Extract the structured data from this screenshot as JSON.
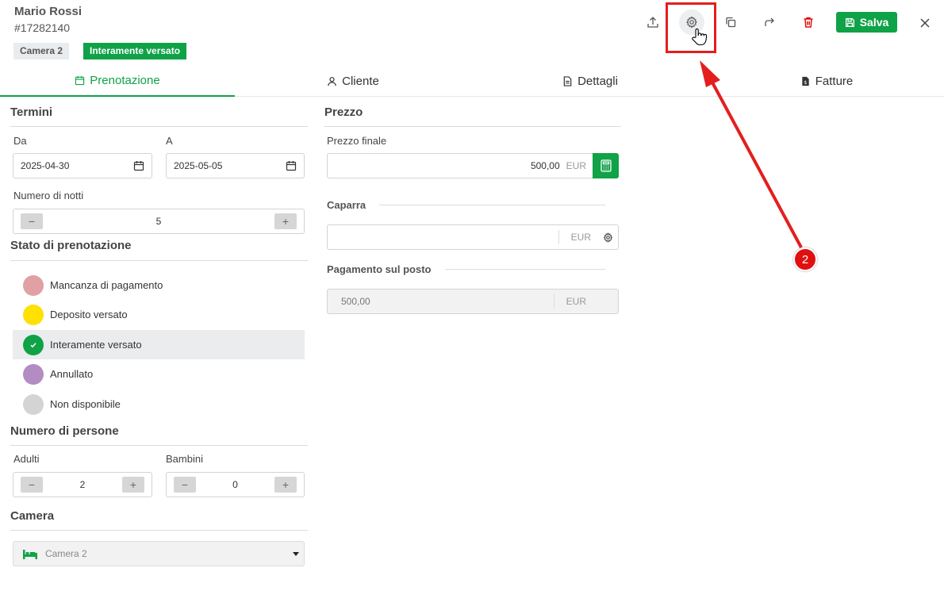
{
  "header": {
    "guest_name": "Mario Rossi",
    "booking_id": "#17282140",
    "room_tag": "Camera 2",
    "status_tag": "Interamente versato",
    "save_label": "Salva",
    "icons": [
      "upload-icon",
      "gear-icon",
      "copy-icon",
      "share-icon",
      "trash-icon",
      "save-icon",
      "close-icon"
    ]
  },
  "tabs": [
    {
      "label": "Prenotazione",
      "icon": "calendar-icon",
      "active": true
    },
    {
      "label": "Cliente",
      "icon": "user-icon",
      "active": false
    },
    {
      "label": "Dettagli",
      "icon": "document-icon",
      "active": false
    },
    {
      "label": "Fatture",
      "icon": "invoice-icon",
      "active": false
    }
  ],
  "termini": {
    "title": "Termini",
    "from_label": "Da",
    "from_value": "2025-04-30",
    "to_label": "A",
    "to_value": "2025-05-05",
    "nights_label": "Numero di notti",
    "nights_value": "5"
  },
  "stato": {
    "title": "Stato di prenotazione",
    "options": [
      {
        "label": "Mancanza di pagamento",
        "color": "#e0a0a4",
        "selected": false
      },
      {
        "label": "Deposito versato",
        "color": "#ffe000",
        "selected": false
      },
      {
        "label": "Interamente versato",
        "color": "#0fa247",
        "selected": true
      },
      {
        "label": "Annullato",
        "color": "#b48cc4",
        "selected": false
      },
      {
        "label": "Non disponibile",
        "color": "#d4d4d4",
        "selected": false
      }
    ]
  },
  "persone": {
    "title": "Numero di persone",
    "adults_label": "Adulti",
    "adults_value": "2",
    "children_label": "Bambini",
    "children_value": "0"
  },
  "camera": {
    "title": "Camera",
    "selected": "Camera 2"
  },
  "prezzo": {
    "title": "Prezzo",
    "final_label": "Prezzo finale",
    "final_value": "500,00",
    "currency": "EUR",
    "deposit_label": "Caparra",
    "deposit_value": "",
    "onsite_label": "Pagamento sul posto",
    "onsite_value": "500,00"
  },
  "annotation": {
    "step_number": "2",
    "color": "#e41e1e"
  }
}
